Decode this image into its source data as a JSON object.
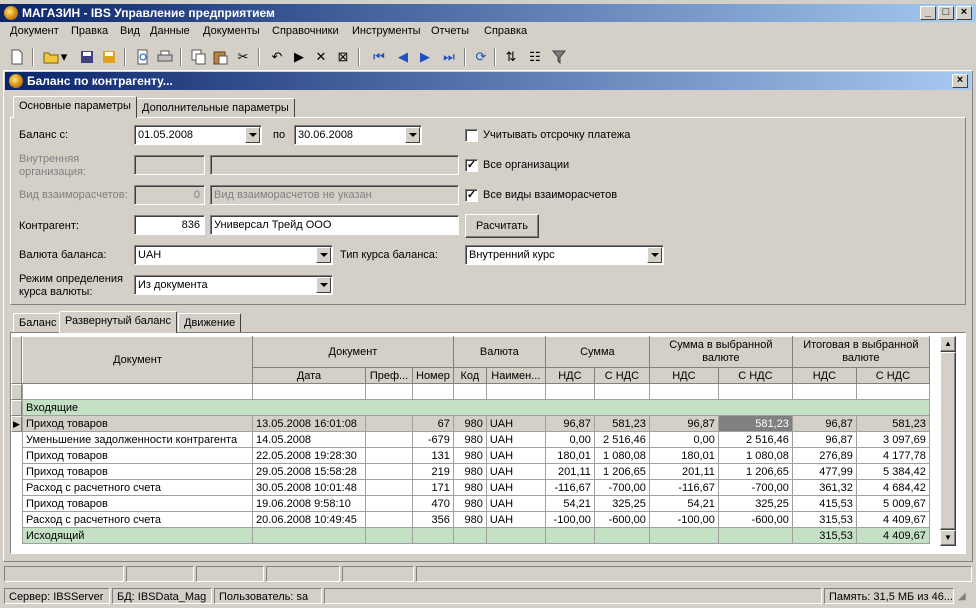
{
  "app": {
    "title": "МАГАЗИН - IBS Управление предприятием",
    "menu": [
      "Документ",
      "Правка",
      "Вид",
      "Данные",
      "Документы",
      "Справочники",
      "Инструменты",
      "Отчеты",
      "Справка"
    ]
  },
  "window": {
    "title": "Баланс по контрагенту...",
    "tabs": [
      "Основные параметры",
      "Дополнительные параметры"
    ]
  },
  "form": {
    "balance_from_label": "Баланс с:",
    "date_from": "01.05.2008",
    "to_label": "по",
    "date_to": "30.06.2008",
    "defer_payment_label": "Учитывать отсрочку платежа",
    "defer_payment_checked": false,
    "internal_org_label": "Внутренняя организация:",
    "all_orgs_label": "Все организации",
    "all_orgs_checked": true,
    "settlement_type_label": "Вид взаиморасчетов:",
    "settlement_type_code": "0",
    "settlement_type_name": "Вид взаиморасчетов не указан",
    "all_settlement_label": "Все виды взаиморасчетов",
    "all_settlement_checked": true,
    "counterparty_label": "Контрагент:",
    "counterparty_code": "836",
    "counterparty_name": "Универсал Трейд ООО",
    "calculate_button": "Расчитать",
    "currency_label": "Валюта баланса:",
    "currency_value": "UAH",
    "rate_type_label": "Тип курса баланса:",
    "rate_type_value": "Внутренний курс",
    "rate_mode_label": "Режим определения курса валюты:",
    "rate_mode_value": "Из документа"
  },
  "result_tabs": [
    "Баланс",
    "Развернутый баланс",
    "Движение"
  ],
  "grid": {
    "headers_top": [
      "Документ",
      "Документ",
      "Валюта",
      "Сумма",
      "Сумма в выбранной валюте",
      "Итоговая в выбранной валюте"
    ],
    "headers_sub": [
      "Дата",
      "Преф...",
      "Номер",
      "Код",
      "Наимен...",
      "НДС",
      "С НДС",
      "НДС",
      "С НДС",
      "НДС",
      "С НДС"
    ],
    "group_in": "Входящие",
    "group_out": "Исходящий",
    "out_totals": [
      "315,53",
      "4 409,67"
    ],
    "rows": [
      [
        "Приход товаров",
        "13.05.2008 16:01:08",
        "",
        "67",
        "980",
        "UAH",
        "96,87",
        "581,23",
        "96,87",
        "581,23",
        "96,87",
        "581,23"
      ],
      [
        "Уменьшение задолженности контрагента",
        "14.05.2008",
        "",
        "-679",
        "980",
        "UAH",
        "0,00",
        "2 516,46",
        "0,00",
        "2 516,46",
        "96,87",
        "3 097,69"
      ],
      [
        "Приход товаров",
        "22.05.2008 19:28:30",
        "",
        "131",
        "980",
        "UAH",
        "180,01",
        "1 080,08",
        "180,01",
        "1 080,08",
        "276,89",
        "4 177,78"
      ],
      [
        "Приход товаров",
        "29.05.2008 15:58:28",
        "",
        "219",
        "980",
        "UAH",
        "201,11",
        "1 206,65",
        "201,11",
        "1 206,65",
        "477,99",
        "5 384,42"
      ],
      [
        "Расход с расчетного счета",
        "30.05.2008 10:01:48",
        "",
        "171",
        "980",
        "UAH",
        "-116,67",
        "-700,00",
        "-116,67",
        "-700,00",
        "361,32",
        "4 684,42"
      ],
      [
        "Приход товаров",
        "19.06.2008 9:58:10",
        "",
        "470",
        "980",
        "UAH",
        "54,21",
        "325,25",
        "54,21",
        "325,25",
        "415,53",
        "5 009,67"
      ],
      [
        "Расход с расчетного счета",
        "20.06.2008 10:49:45",
        "",
        "356",
        "980",
        "UAH",
        "-100,00",
        "-600,00",
        "-100,00",
        "-600,00",
        "315,53",
        "4 409,67"
      ]
    ]
  },
  "status": {
    "server": "Сервер: IBSServer",
    "db": "БД: IBSData_Mag",
    "user": "Пользователь: sa",
    "memory": "Память: 31,5 МБ из 46..."
  }
}
